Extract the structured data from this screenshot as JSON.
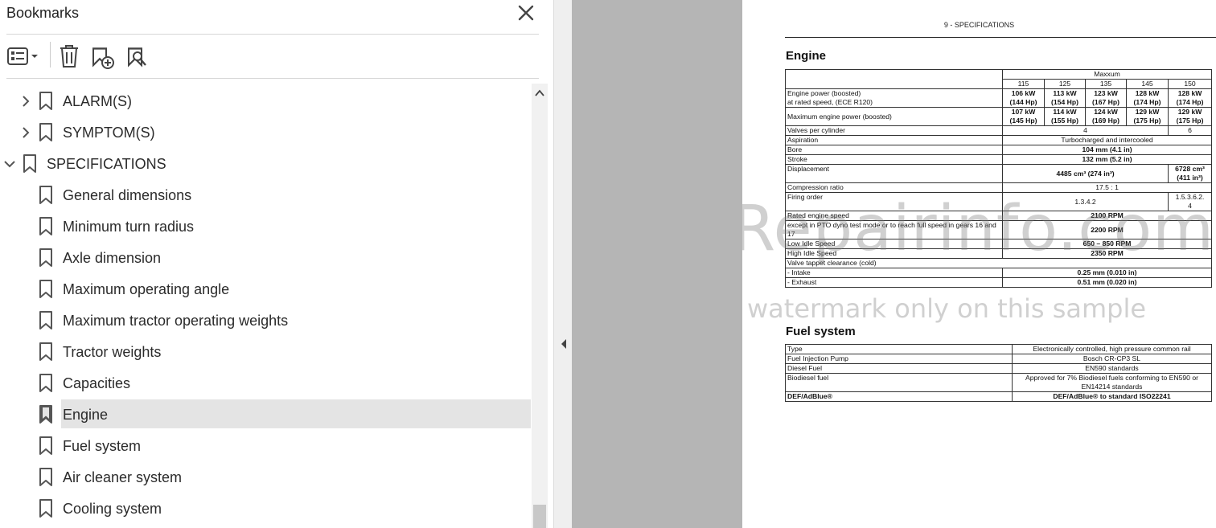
{
  "panel": {
    "title": "Bookmarks",
    "items": [
      {
        "label": "ALARM(S)",
        "level": 1,
        "expandable": true,
        "expanded": false
      },
      {
        "label": "SYMPTOM(S)",
        "level": 1,
        "expandable": true,
        "expanded": false
      },
      {
        "label": "SPECIFICATIONS",
        "level": 0,
        "expandable": true,
        "expanded": true
      },
      {
        "label": "General dimensions",
        "level": 1
      },
      {
        "label": "Minimum turn radius",
        "level": 1
      },
      {
        "label": "Axle dimension",
        "level": 1
      },
      {
        "label": "Maximum operating angle",
        "level": 1
      },
      {
        "label": "Maximum tractor operating weights",
        "level": 1
      },
      {
        "label": "Tractor weights",
        "level": 1
      },
      {
        "label": "Capacities",
        "level": 1
      },
      {
        "label": "Engine",
        "level": 1,
        "selected": true
      },
      {
        "label": "Fuel system",
        "level": 1
      },
      {
        "label": "Air cleaner system",
        "level": 1
      },
      {
        "label": "Cooling system",
        "level": 1
      }
    ]
  },
  "document": {
    "header": "9 - SPECIFICATIONS",
    "engine": {
      "title": "Engine",
      "group": "Maxxum",
      "models": [
        "115",
        "125",
        "135",
        "145",
        "150"
      ],
      "power_label": [
        "Engine power (boosted)",
        "at rated speed, (ECE R120)"
      ],
      "power": [
        [
          "106 kW",
          "(144 Hp)"
        ],
        [
          "113 kW",
          "(154 Hp)"
        ],
        [
          "123 kW",
          "(167 Hp)"
        ],
        [
          "128 kW",
          "(174 Hp)"
        ],
        [
          "128 kW",
          "(174 Hp)"
        ]
      ],
      "max_label": "Maximum engine power (boosted)",
      "max_power": [
        [
          "107 kW",
          "(145 Hp)"
        ],
        [
          "114 kW",
          "(155 Hp)"
        ],
        [
          "124 kW",
          "(169 Hp)"
        ],
        [
          "129 kW",
          "(175 Hp)"
        ],
        [
          "129 kW",
          "(175 Hp)"
        ]
      ],
      "valves_label": "Valves per cylinder",
      "valves_a": "4",
      "valves_b": "6",
      "aspiration_label": "Aspiration",
      "aspiration": "Turbocharged and intercooled",
      "bore_label": "Bore",
      "bore": "104 mm (4.1 in)",
      "stroke_label": "Stroke",
      "stroke": "132 mm (5.2 in)",
      "disp_label": "Displacement",
      "disp_a": "4485 cm³ (274 in³)",
      "disp_b1": "6728 cm³",
      "disp_b2": "(411 in³)",
      "comp_label": "Compression ratio",
      "comp": "17.5 : 1",
      "firing_label": "Firing order",
      "firing_a": "1.3.4.2",
      "firing_b1": "1.5.3.6.2.",
      "firing_b2": "4",
      "rated_label": "Rated engine speed",
      "rated": "2100 RPM",
      "pto_label": "except in PTO dyno test mode or to reach full speed in gears 16 and 17",
      "pto": "2200 RPM",
      "low_label": "Low Idle Speed",
      "low": "650 – 850 RPM",
      "high_label": "High Idle Speed",
      "high": "2350 RPM",
      "tappet_label": "Valve tappet clearance (cold)",
      "intake_label": "- Intake",
      "intake": "0.25 mm (0.010 in)",
      "exhaust_label": "- Exhaust",
      "exhaust": "0.51 mm (0.020 in)"
    },
    "fuel": {
      "title": "Fuel system",
      "rows": [
        {
          "label": "Type",
          "value": "Electronically controlled, high pressure common rail"
        },
        {
          "label": "Fuel Injection Pump",
          "value": "Bosch CR-CP3 SL"
        },
        {
          "label": "Diesel Fuel",
          "value": "EN590 standards"
        },
        {
          "label": "Biodiesel fuel",
          "value": "Approved for 7% Biodiesel fuels conforming to EN590 or EN14214 standards"
        },
        {
          "label": "DEF/AdBlue®",
          "value": "DEF/AdBlue® to standard ISO22241"
        }
      ]
    },
    "watermark": "eRepairinfo.com",
    "watermark_sub": "watermark only on this sample"
  }
}
